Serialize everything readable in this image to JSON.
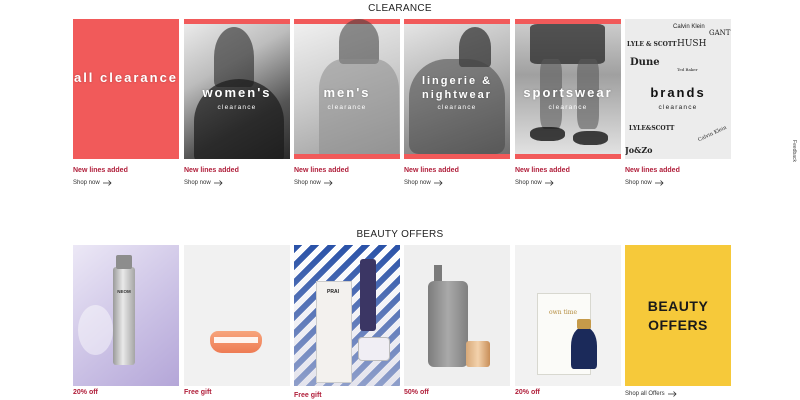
{
  "clearance": {
    "title": "CLEARANCE",
    "cards": [
      {
        "title": "all clearance",
        "subtitle": "",
        "status": "New lines added",
        "cta": "Shop now"
      },
      {
        "title": "women's",
        "subtitle": "clearance",
        "status": "New lines added",
        "cta": "Shop now"
      },
      {
        "title": "men's",
        "subtitle": "clearance",
        "status": "New lines added",
        "cta": "Shop now"
      },
      {
        "title": "lingerie & nightwear",
        "subtitle": "clearance",
        "status": "New lines added",
        "cta": "Shop now"
      },
      {
        "title": "sportswear",
        "subtitle": "clearance",
        "status": "New lines added",
        "cta": "Shop now"
      },
      {
        "title": "brands",
        "subtitle": "clearance",
        "status": "New lines added",
        "cta": "Shop now"
      }
    ],
    "brand_logos": [
      "Calvin Klein",
      "LYLE & SCOTT",
      "HUSH",
      "Dune",
      "GANT",
      "Ted Baker",
      "Calvin Klein",
      "LYLE&SCOTT",
      "Jo&Zo"
    ]
  },
  "beauty": {
    "title": "BEAUTY OFFERS",
    "cards": [
      {
        "offer": "20% off",
        "product_text": "NEOM"
      },
      {
        "offer": "Free gift",
        "product_text": ""
      },
      {
        "offer": "Free gift",
        "product_text": "PRAI"
      },
      {
        "offer": "50% off",
        "product_text": ""
      },
      {
        "offer": "20% off",
        "product_text": "own time"
      },
      {
        "offer": "Shop all Offers",
        "panel_title": "BEAUTY OFFERS"
      }
    ]
  },
  "feedback_label": "Feedback",
  "colors": {
    "accent_red": "#f15a5a",
    "status_red": "#b01e3a",
    "beauty_yellow": "#f6c93a"
  }
}
